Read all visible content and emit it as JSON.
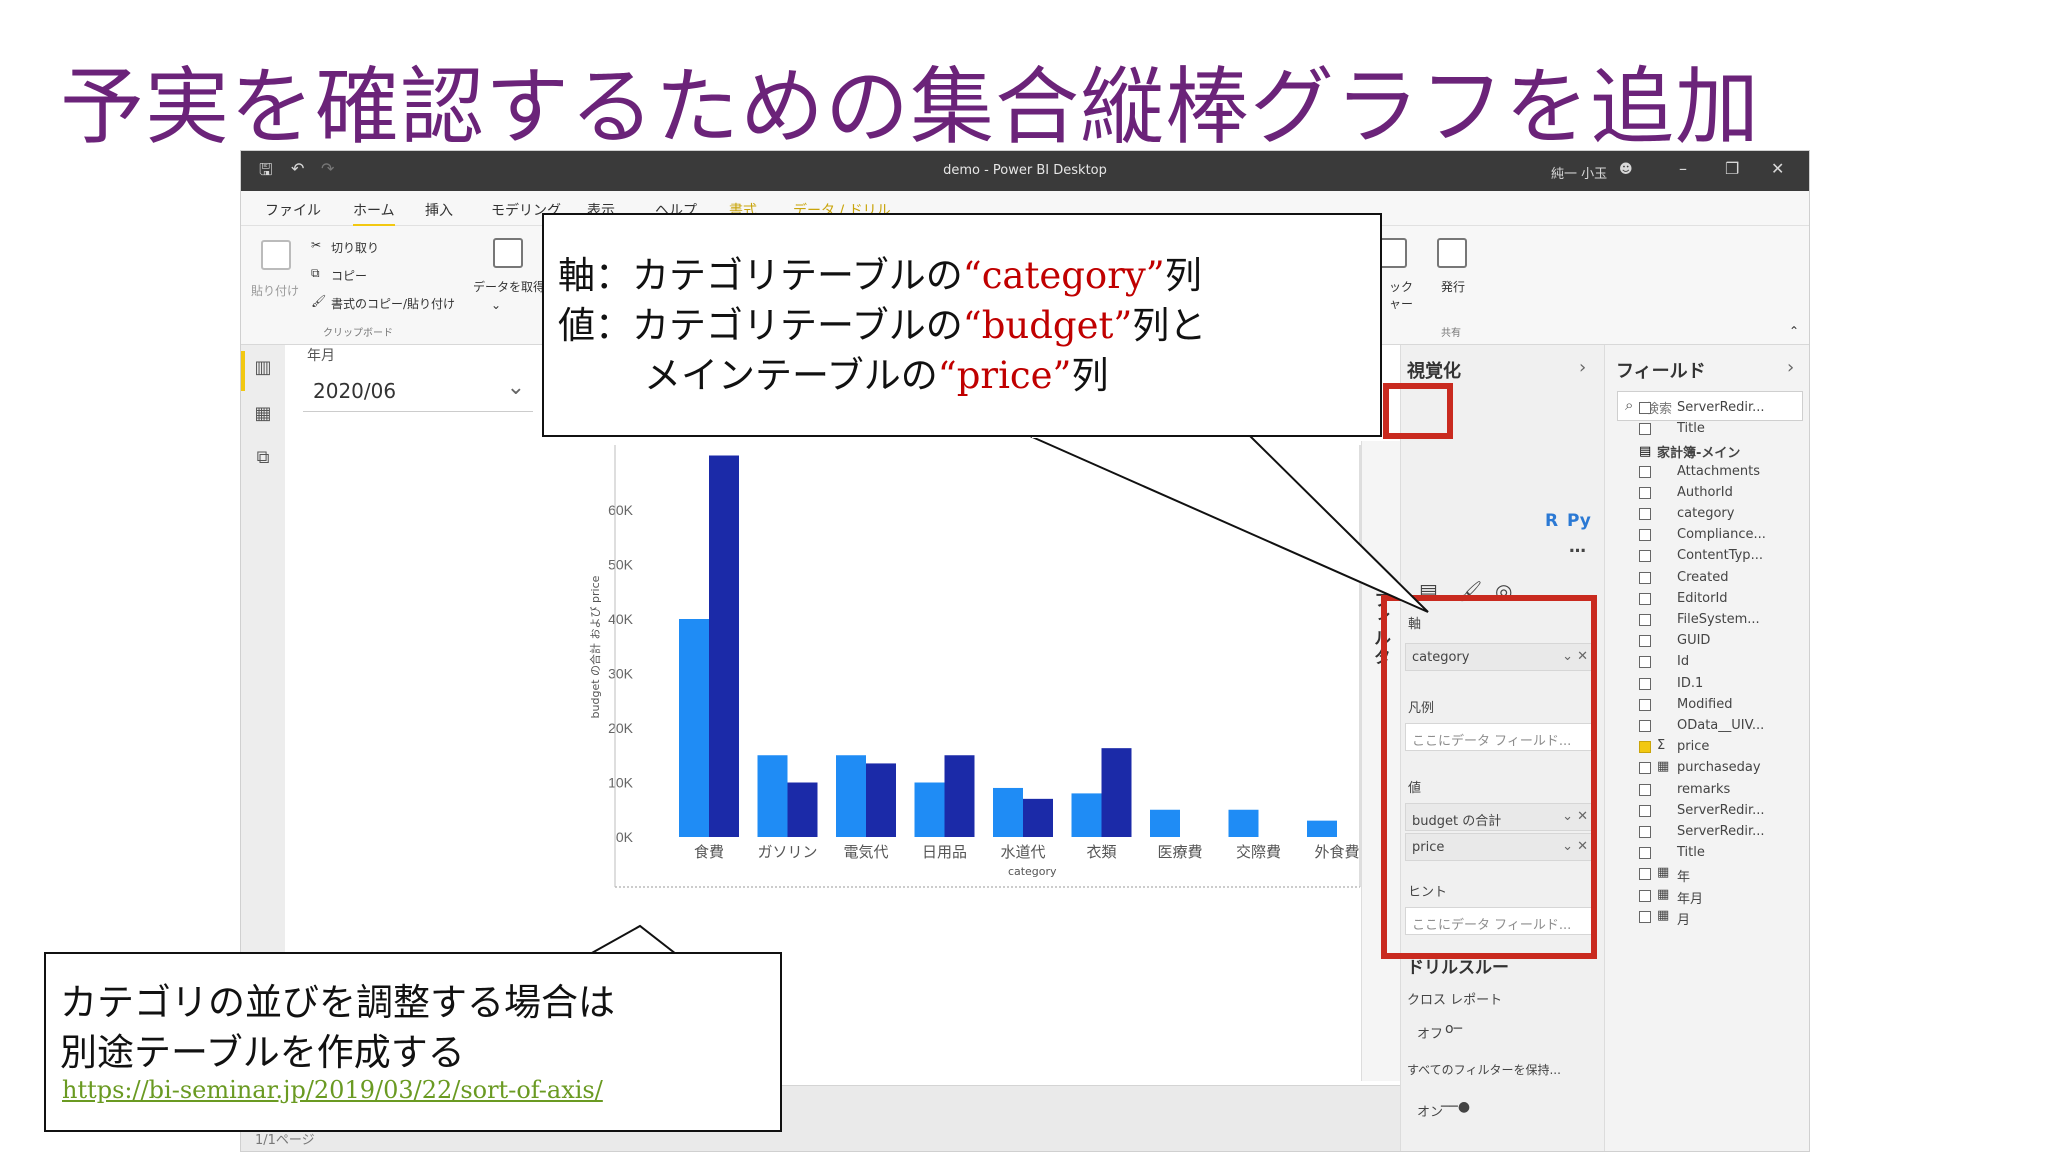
{
  "slide": {
    "title": "予実を確認するための集合縦棒グラフを追加"
  },
  "window": {
    "title": "demo - Power BI Desktop",
    "user": "純一 小玉",
    "minimize": "–",
    "restore": "❐",
    "close": "✕"
  },
  "ribbon": {
    "tabs": [
      "ファイル",
      "ホーム",
      "挿入",
      "モデリング",
      "表示",
      "ヘルプ",
      "書式",
      "データ / ドリル"
    ],
    "active_tab": "ホーム",
    "paste": "貼り付け",
    "cut": "切り取り",
    "copy": "コピー",
    "format_painter": "書式のコピー/貼り付け",
    "clipboard_group": "クリップボード",
    "get_data": "データを取得",
    "quick_measure_partial": "ック\nャー",
    "publish": "発行",
    "share_group": "共有"
  },
  "slicer": {
    "label": "年月",
    "value": "2020/06"
  },
  "chart_data": {
    "type": "bar",
    "categories": [
      "食費",
      "ガソリン",
      "電気代",
      "日用品",
      "水道代",
      "衣類",
      "医療費",
      "交際費",
      "外食費"
    ],
    "series": [
      {
        "name": "budget の合計",
        "values": [
          40000,
          15000,
          15000,
          10000,
          9000,
          8000,
          5000,
          5000,
          3000
        ],
        "color": "#1f8cf5"
      },
      {
        "name": "price",
        "values": [
          70000,
          10000,
          13500,
          15000,
          7000,
          16300,
          null,
          null,
          null
        ],
        "color": "#1b2aa8"
      }
    ],
    "ylim": [
      0,
      65000
    ],
    "yticks": [
      "0K",
      "10K",
      "20K",
      "30K",
      "40K",
      "50K",
      "60K"
    ],
    "xlabel": "category",
    "ylabel": "budget の合計 および price"
  },
  "visualizations": {
    "header": "視覚化",
    "extra_glyphs": [
      "R",
      "Py",
      "…"
    ]
  },
  "filters": {
    "label": "フィルター"
  },
  "wells": {
    "axis_label": "軸",
    "axis_value": "category",
    "legend_label": "凡例",
    "legend_placeholder": "ここにデータ フィールド...",
    "values_label": "値",
    "value1": "budget の合計",
    "value2": "price",
    "tooltips_label": "ヒント",
    "tooltips_placeholder": "ここにデータ フィールド...",
    "drillthrough": "ドリルスルー",
    "cross_report": "クロス レポート",
    "off": "オフ",
    "keep_filters": "すべてのフィルターを保持...",
    "on": "オン"
  },
  "fields": {
    "header": "フィールド",
    "search_placeholder": "検索",
    "rows": [
      {
        "label": "ServerRedir...",
        "checked": false,
        "icon": ""
      },
      {
        "label": "Title",
        "checked": false,
        "icon": ""
      },
      {
        "label": "家計簿-メイン",
        "checked": false,
        "icon": "table",
        "table": true
      },
      {
        "label": "Attachments",
        "checked": false,
        "icon": ""
      },
      {
        "label": "AuthorId",
        "checked": false,
        "icon": ""
      },
      {
        "label": "category",
        "checked": false,
        "icon": ""
      },
      {
        "label": "Compliance...",
        "checked": false,
        "icon": ""
      },
      {
        "label": "ContentTyp...",
        "checked": false,
        "icon": ""
      },
      {
        "label": "Created",
        "checked": false,
        "icon": ""
      },
      {
        "label": "EditorId",
        "checked": false,
        "icon": ""
      },
      {
        "label": "FileSystem...",
        "checked": false,
        "icon": ""
      },
      {
        "label": "GUID",
        "checked": false,
        "icon": ""
      },
      {
        "label": "Id",
        "checked": false,
        "icon": ""
      },
      {
        "label": "ID.1",
        "checked": false,
        "icon": ""
      },
      {
        "label": "Modified",
        "checked": false,
        "icon": ""
      },
      {
        "label": "OData__UIV...",
        "checked": false,
        "icon": ""
      },
      {
        "label": "price",
        "checked": true,
        "icon": "Σ"
      },
      {
        "label": "purchaseday",
        "checked": false,
        "icon": "cal"
      },
      {
        "label": "remarks",
        "checked": false,
        "icon": ""
      },
      {
        "label": "ServerRedir...",
        "checked": false,
        "icon": ""
      },
      {
        "label": "ServerRedir...",
        "checked": false,
        "icon": ""
      },
      {
        "label": "Title",
        "checked": false,
        "icon": ""
      },
      {
        "label": "年",
        "checked": false,
        "icon": "tbl"
      },
      {
        "label": "年月",
        "checked": false,
        "icon": "tbl"
      },
      {
        "label": "月",
        "checked": false,
        "icon": "tbl"
      }
    ]
  },
  "callout": {
    "line1_prefix": "軸：カテゴリテーブルの",
    "line1_red": "“category”",
    "line1_suffix": "列",
    "line2_prefix": "値：カテゴリテーブルの",
    "line2_red": "“budget”",
    "line2_suffix": "列と",
    "line3_prefix": "メインテーブルの",
    "line3_red": "“price”",
    "line3_suffix": "列"
  },
  "note": {
    "line1": "カテゴリの並びを調整する場合は",
    "line2": "別途テーブルを作成する",
    "link": "https://bi-seminar.jp/2019/03/22/sort-of-axis/"
  },
  "footer": {
    "page": "1/1ページ"
  }
}
